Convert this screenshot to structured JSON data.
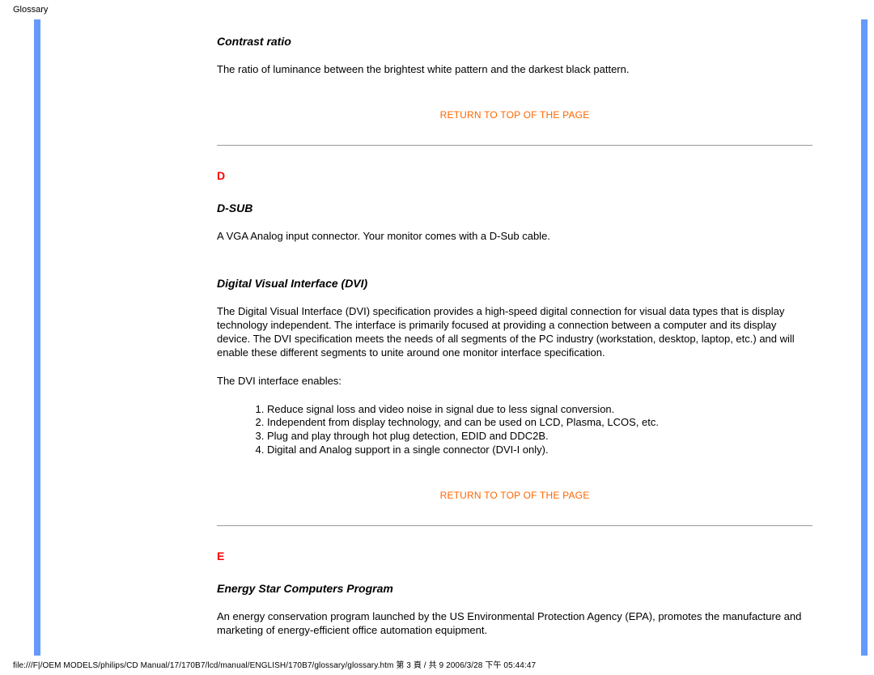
{
  "page_label": "Glossary",
  "footer": "file:///F|/OEM MODELS/philips/CD Manual/17/170B7/lcd/manual/ENGLISH/170B7/glossary/glossary.htm 第 3 頁 / 共 9 2006/3/28 下午 05:44:47",
  "return_link": "RETURN TO TOP OF THE PAGE",
  "sections": {
    "contrast": {
      "title": "Contrast ratio",
      "body": "The ratio of luminance between the brightest white pattern and the darkest black pattern."
    },
    "letter_d": "D",
    "dsub": {
      "title": "D-SUB",
      "body": "A VGA Analog input connector. Your monitor comes with a D-Sub cable."
    },
    "dvi": {
      "title": "Digital Visual Interface (DVI)",
      "body": "The Digital Visual Interface (DVI) specification provides a high-speed digital connection for visual data types that is display technology independent. The interface is primarily focused at providing a connection between a computer and its display device. The DVI specification meets the needs of all segments of the PC industry (workstation, desktop, laptop, etc.) and will enable these different segments to unite around one monitor interface specification.",
      "enables_intro": "The DVI interface enables:",
      "list": [
        "Reduce signal loss and video noise in signal due to less signal conversion.",
        "Independent from display technology, and can be used on LCD, Plasma, LCOS, etc.",
        "Plug and play through hot plug detection, EDID and DDC2B.",
        "Digital and Analog support in a single connector (DVI-I only)."
      ]
    },
    "letter_e": "E",
    "energystar": {
      "title": "Energy Star Computers Program",
      "body": "An energy conservation program launched by the US Environmental Protection Agency (EPA), promotes the manufacture and marketing of energy-efficient office automation equipment."
    }
  }
}
